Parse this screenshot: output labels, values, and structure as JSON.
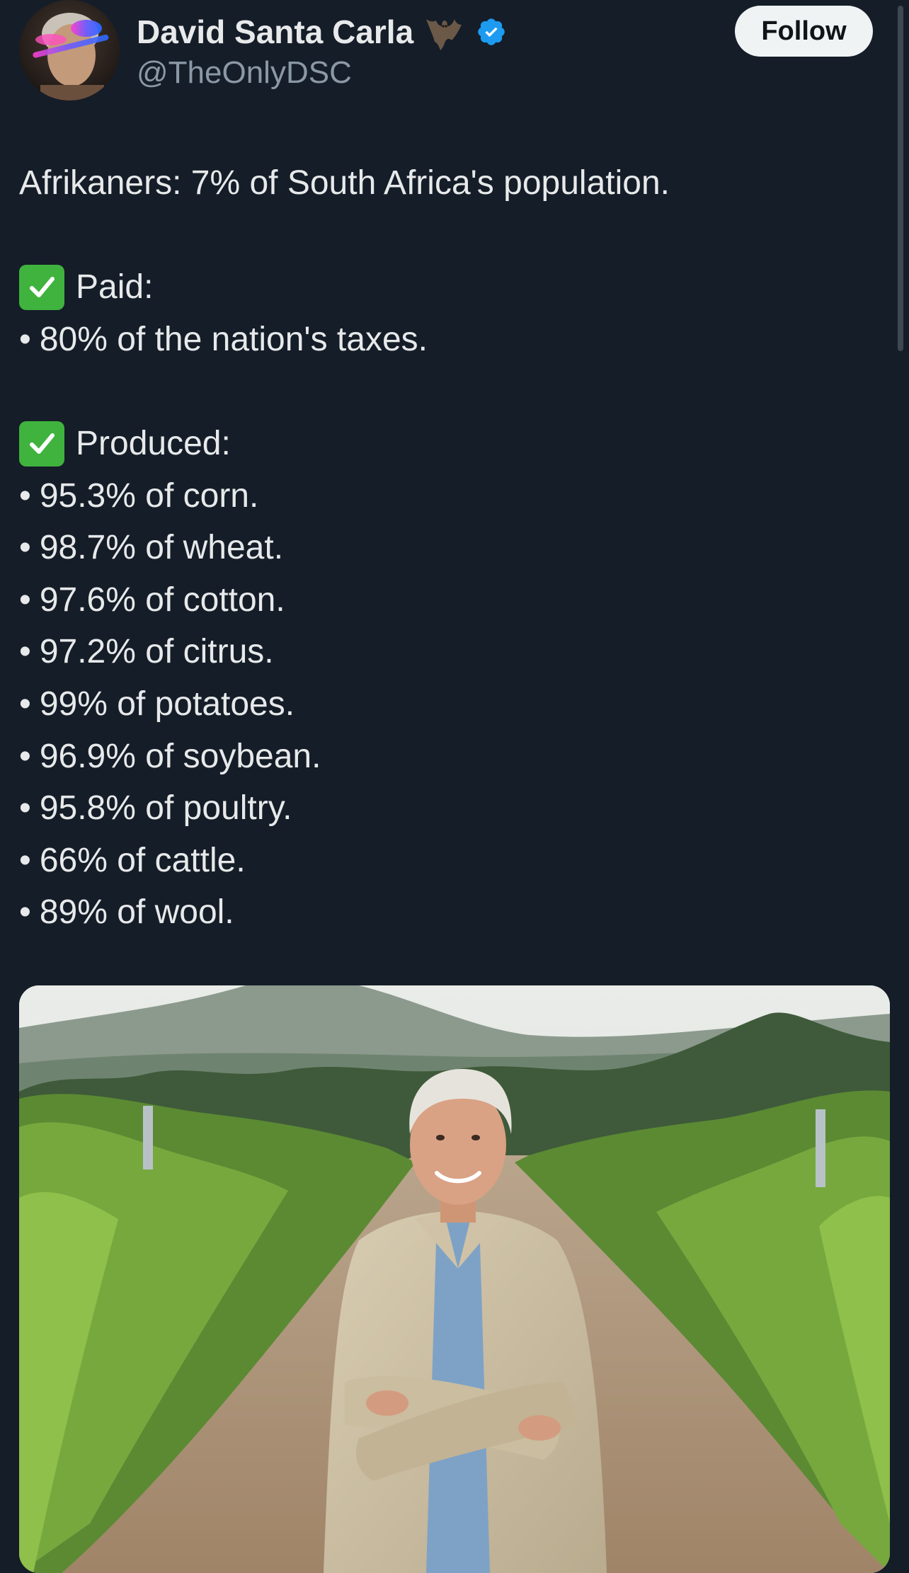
{
  "author": {
    "display_name": "David Santa Carla",
    "handle": "@TheOnlyDSC",
    "name_emoji": "bat-icon",
    "verified": true,
    "verified_color": "#1d9bf0"
  },
  "follow_button": {
    "label": "Follow"
  },
  "tweet": {
    "intro": "Afrikaners: 7% of South Africa's population.",
    "paid_heading": "Paid:",
    "paid_items": [
      "80% of the nation's taxes."
    ],
    "produced_heading": "Produced:",
    "produced_items": [
      "95.3% of corn.",
      "98.7% of wheat.",
      "97.6% of cotton.",
      "97.2% of citrus.",
      "99% of potatoes.",
      "96.9% of soybean.",
      "95.8% of poultry.",
      "66% of cattle.",
      "89% of wool."
    ],
    "bullet": "•",
    "heading_emoji": "check-mark-button-emoji"
  },
  "colors": {
    "background": "#151d28",
    "text": "#e7e9ea",
    "muted": "#8b98a5",
    "check_green": "#3fb33d"
  }
}
